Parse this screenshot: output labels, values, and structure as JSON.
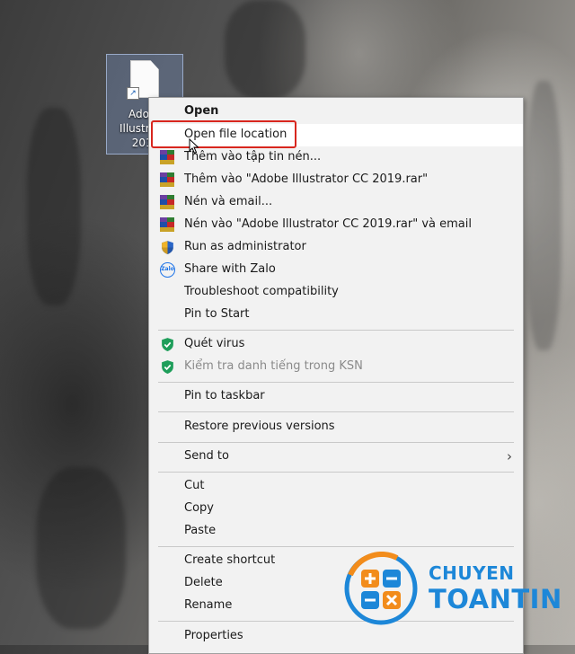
{
  "desktop_icon": {
    "label": "Adobe\nIllustrator\n2019"
  },
  "menu": {
    "items": [
      {
        "label": "Open",
        "icon": ""
      },
      {
        "label": "Open file location",
        "icon": ""
      },
      {
        "label": "Thêm vào tập tin nén...",
        "icon": "winrar-icon"
      },
      {
        "label": "Thêm vào \"Adobe Illustrator CC 2019.rar\"",
        "icon": "winrar-icon"
      },
      {
        "label": "Nén và email...",
        "icon": "winrar-icon"
      },
      {
        "label": "Nén vào \"Adobe Illustrator CC 2019.rar\" và email",
        "icon": "winrar-icon"
      },
      {
        "label": "Run as administrator",
        "icon": "uac-shield-icon"
      },
      {
        "label": "Share with Zalo",
        "icon": "zalo-icon"
      },
      {
        "label": "Troubleshoot compatibility",
        "icon": ""
      },
      {
        "label": "Pin to Start",
        "icon": ""
      },
      {
        "label": "Quét virus",
        "icon": "kaspersky-shield-icon"
      },
      {
        "label": "Kiểm tra danh tiếng trong KSN",
        "icon": "kaspersky-shield-icon"
      },
      {
        "label": "Pin to taskbar",
        "icon": ""
      },
      {
        "label": "Restore previous versions",
        "icon": ""
      },
      {
        "label": "Send to",
        "icon": "chevron-right-icon"
      },
      {
        "label": "Cut",
        "icon": ""
      },
      {
        "label": "Copy",
        "icon": ""
      },
      {
        "label": "Paste",
        "icon": ""
      },
      {
        "label": "Create shortcut",
        "icon": ""
      },
      {
        "label": "Delete",
        "icon": ""
      },
      {
        "label": "Rename",
        "icon": ""
      },
      {
        "label": "Properties",
        "icon": ""
      }
    ]
  },
  "logo": {
    "line1": "CHUYEN",
    "line2": "TOANTIN"
  },
  "colors": {
    "highlight": "#d8261e",
    "logo_blue": "#1d87d8",
    "logo_orange": "#f28c1b",
    "shield_green": "#1e9e5a"
  }
}
